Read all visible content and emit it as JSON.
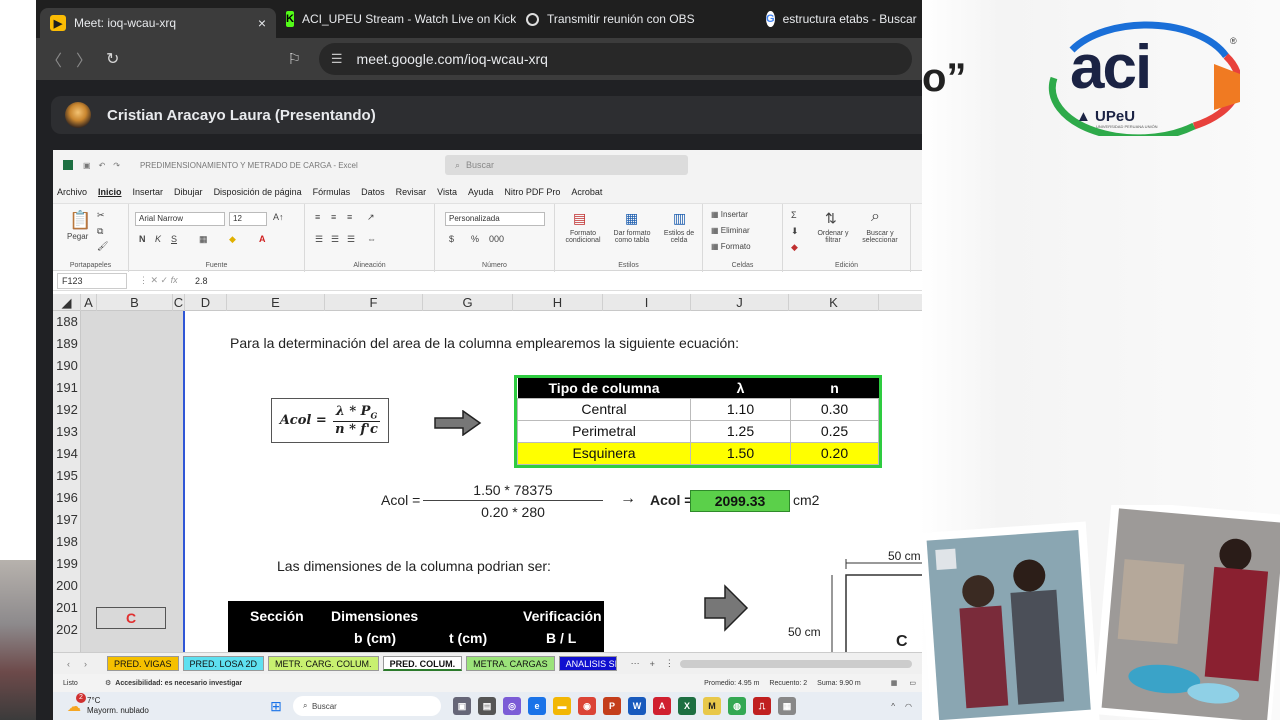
{
  "slide": {
    "title_fragment": "o”"
  },
  "logo": {
    "text_main": "aci",
    "text_sub": "UPeU",
    "reg_mark": "®",
    "tagline": "UNIVERSIDAD PERUANA UNIÓN"
  },
  "browser": {
    "tabs": [
      {
        "label": "Meet: ioq-wcau-xrq",
        "icon": "meet-icon"
      },
      {
        "label": "ACI_UPEU Stream - Watch Live on Kick",
        "icon": "kick-icon"
      },
      {
        "label": "Transmitir reunión con OBS",
        "icon": "obs-icon"
      },
      {
        "label": "estructura etabs - Buscar",
        "icon": "google-icon"
      }
    ],
    "close_glyph": "×",
    "url": "meet.google.com/ioq-wcau-xrq"
  },
  "meet": {
    "presenter": "Cristian Aracayo Laura (Presentando)"
  },
  "excel": {
    "title": "PREDIMENSIONAMIENTO Y METRADO DE CARGA - Excel",
    "search_placeholder": "Buscar",
    "menu": [
      "Archivo",
      "Inicio",
      "Insertar",
      "Dibujar",
      "Disposición de página",
      "Fórmulas",
      "Datos",
      "Revisar",
      "Vista",
      "Ayuda",
      "Nitro PDF Pro",
      "Acrobat"
    ],
    "active_menu": "Inicio",
    "ribbon": {
      "clipboard": {
        "paste": "Pegar",
        "label": "Portapapeles"
      },
      "font": {
        "name": "Arial Narrow",
        "size": "12",
        "label": "Fuente"
      },
      "alignment": {
        "label": "Alineación"
      },
      "number": {
        "format": "Personalizada",
        "label": "Número"
      },
      "styles": {
        "cond": "Formato condicional",
        "table": "Dar formato como tabla",
        "cell": "Estilos de celda",
        "label": "Estilos"
      },
      "cells": {
        "insert": "Insertar",
        "delete": "Eliminar",
        "format": "Formato",
        "label": "Celdas"
      },
      "editing": {
        "sort": "Ordenar y filtrar",
        "find": "Buscar y seleccionar",
        "label": "Edición"
      }
    },
    "name_box": "F123",
    "formula_value": "2.8",
    "columns": [
      "A",
      "B",
      "C",
      "D",
      "E",
      "F",
      "G",
      "H",
      "I",
      "J",
      "K"
    ],
    "rows": [
      "188",
      "189",
      "190",
      "191",
      "192",
      "193",
      "194",
      "195",
      "196",
      "197",
      "198",
      "199",
      "200",
      "201",
      "202"
    ],
    "sheet": {
      "intro": "Para la determinación del area de la columna emplearemos la siguiente ecuación:",
      "formula": {
        "lhs": "Acol =",
        "num": "λ * P",
        "num_sub": "G",
        "den": "n * f'c"
      },
      "table": {
        "headers": [
          "Tipo de columna",
          "λ",
          "n"
        ],
        "rows": [
          {
            "tipo": "Central",
            "lambda": "1.10",
            "n": "0.30"
          },
          {
            "tipo": "Perimetral",
            "lambda": "1.25",
            "n": "0.25"
          },
          {
            "tipo": "Esquinera",
            "lambda": "1.50",
            "n": "0.20"
          }
        ]
      },
      "calc": {
        "lhs": "Acol =",
        "numerator": "1.50 * 78375",
        "denominator": "0.20 * 280",
        "arrow": "→",
        "result_label": "Acol =",
        "result": "2099.33",
        "unit": "cm2"
      },
      "dims_text": "Las dimensiones de la columna podrian ser:",
      "section_table": {
        "h1": "Sección",
        "h2": "Dimensiones",
        "h3": "Verificación",
        "sub_b": "b (cm)",
        "sub_t": "t (cm)",
        "sub_bl": "B / L"
      },
      "red_cell": "C",
      "diagram": {
        "top": "50 cm",
        "side": "50 cm",
        "label": "C"
      }
    },
    "sheet_tabs": [
      {
        "label": "PRED. VIGAS",
        "color": "#f5c000"
      },
      {
        "label": "PRED. LOSA 2D",
        "color": "#5ee0f0"
      },
      {
        "label": "METR. CARG. COLUM.",
        "color": "#c8f070"
      },
      {
        "label": "PRED. COLUM.",
        "color": "#ffffff"
      },
      {
        "label": "METRA. CARGAS",
        "color": "#9be37a"
      },
      {
        "label": "ANALISIS SIS",
        "color": "#1010d0"
      }
    ],
    "status": {
      "ready": "Listo",
      "accessibility": "Accesibilidad: es necesario investigar",
      "average": "Promedio: 4.95 m",
      "count": "Recuento: 2",
      "sum": "Suma: 9.90 m"
    }
  },
  "taskbar": {
    "temp": "7°C",
    "weather": "Mayorm. nublado",
    "search": "Buscar",
    "badge": "2"
  }
}
